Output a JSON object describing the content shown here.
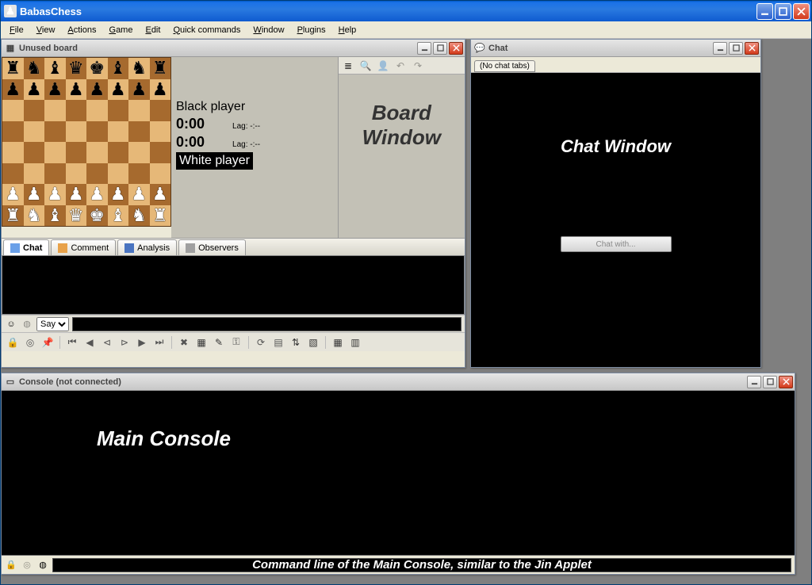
{
  "app": {
    "title": "BabasChess"
  },
  "menu": [
    "File",
    "View",
    "Actions",
    "Game",
    "Edit",
    "Quick commands",
    "Window",
    "Plugins",
    "Help"
  ],
  "board_window": {
    "title": "Unused board",
    "black_label": "Black player",
    "white_label": "White player",
    "black_time": "0:00",
    "white_time": "0:00",
    "lag_label": "Lag:",
    "lag_value": "-:--",
    "overlay": "Board\nWindow",
    "tabs": [
      "Chat",
      "Comment",
      "Analysis",
      "Observers"
    ],
    "say_label": "Say",
    "say_options": [
      "Say"
    ]
  },
  "chat_window": {
    "title": "Chat",
    "tab": "(No chat tabs)",
    "overlay": "Chat Window",
    "button": "Chat with..."
  },
  "console_window": {
    "title": "Console (not connected)",
    "overlay": "Main Console",
    "cmd_overlay": "Command line of the Main Console, similar to the Jin Applet"
  },
  "pieces": {
    "back_black": [
      "♜",
      "♞",
      "♝",
      "♛",
      "♚",
      "♝",
      "♞",
      "♜"
    ],
    "pawn_black": "♟",
    "back_white": [
      "♜",
      "♞",
      "♝",
      "♛",
      "♚",
      "♝",
      "♞",
      "♜"
    ],
    "pawn_white": "♟"
  }
}
